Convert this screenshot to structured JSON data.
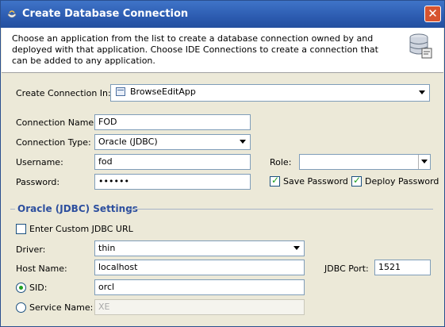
{
  "window": {
    "title": "Create Database Connection",
    "close_glyph": "✕"
  },
  "banner": {
    "description": "Choose an application from the list to create a database connection owned by and deployed with that application. Choose IDE Connections to create a connection that can be added to any application."
  },
  "create_in": {
    "label": "Create Connection In:",
    "value": "BrowseEditApp"
  },
  "connection_name": {
    "label": "Connection Name:",
    "value": "FOD"
  },
  "connection_type": {
    "label": "Connection Type:",
    "value": "Oracle (JDBC)"
  },
  "username": {
    "label": "Username:",
    "value": "fod"
  },
  "role": {
    "label": "Role:",
    "value": ""
  },
  "password": {
    "label": "Password:",
    "value": "••••••"
  },
  "save_password": {
    "label": "Save Password",
    "checked": true
  },
  "deploy_password": {
    "label": "Deploy Password",
    "checked": true
  },
  "section": {
    "title": "Oracle (JDBC) Settings"
  },
  "custom_url": {
    "label": "Enter Custom JDBC URL",
    "checked": false
  },
  "driver": {
    "label": "Driver:",
    "value": "thin"
  },
  "host": {
    "label": "Host Name:",
    "value": "localhost"
  },
  "jdbc_port": {
    "label": "JDBC Port:",
    "value": "1521"
  },
  "sid": {
    "label": "SID:",
    "value": "orcl",
    "selected": true
  },
  "service_name": {
    "label": "Service Name:",
    "value": "XE",
    "selected": false
  },
  "colors": {
    "title_bar": "#2c5bb0",
    "accent": "#2d4f9e",
    "check": "#21a121"
  }
}
